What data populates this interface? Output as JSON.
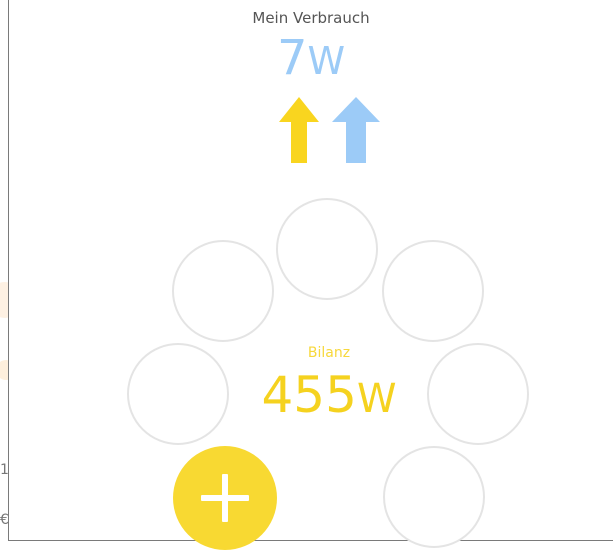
{
  "consumption": {
    "label": "Mein Verbrauch",
    "value": "7",
    "unit": "W"
  },
  "balance": {
    "label": "Bilanz",
    "value": "455",
    "unit": "W"
  },
  "icons": {
    "arrow_yellow": "arrow-up-icon",
    "arrow_blue": "arrow-up-icon",
    "add": "plus-icon"
  },
  "colors": {
    "yellow": "#f8d932",
    "blue": "#9ccbf7",
    "slot_border": "#e4e4e4"
  },
  "edge": {
    "fragment_1": "1",
    "fragment_2": "€"
  }
}
